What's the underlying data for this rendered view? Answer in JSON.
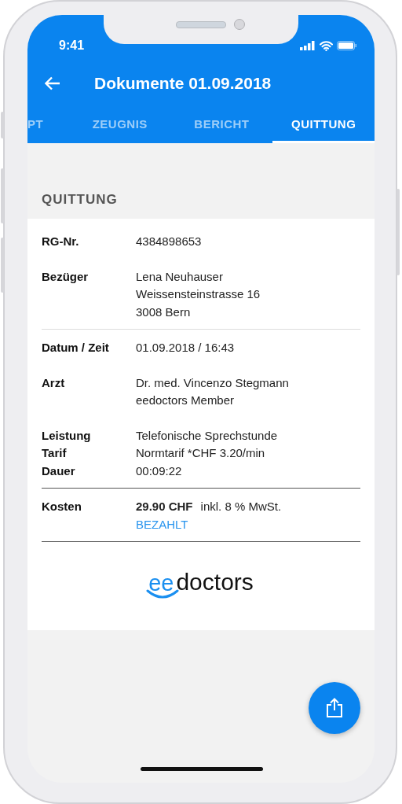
{
  "status_bar": {
    "time": "9:41"
  },
  "header": {
    "title": "Dokumente 01.09.2018"
  },
  "tabs": [
    {
      "label": "PT",
      "selected": false
    },
    {
      "label": "ZEUGNIS",
      "selected": false
    },
    {
      "label": "BERICHT",
      "selected": false
    },
    {
      "label": "QUITTUNG",
      "selected": true
    }
  ],
  "section": {
    "title": "QUITTUNG"
  },
  "groups": [
    {
      "blocks": [
        {
          "kind": "field",
          "lines": [
            {
              "label": "RG-Nr.",
              "value": "4384898653"
            }
          ]
        },
        {
          "kind": "field",
          "lines": [
            {
              "label": "Bezüger",
              "value": "Lena Neuhauser"
            },
            {
              "value": "Weissensteinstrasse 16"
            },
            {
              "value": "3008 Bern"
            }
          ]
        }
      ]
    },
    {
      "blocks": [
        {
          "kind": "field",
          "lines": [
            {
              "label": "Datum / Zeit",
              "value": "01.09.2018 / 16:43"
            }
          ]
        },
        {
          "kind": "field",
          "lines": [
            {
              "label": "Arzt",
              "value": "Dr. med. Vincenzo Stegmann"
            },
            {
              "value": "eedoctors Member"
            }
          ]
        },
        {
          "kind": "field",
          "lines": [
            {
              "label": "Leistung",
              "value": "Telefonische Sprechstunde"
            },
            {
              "label": "Tarif",
              "value": "Normtarif *CHF 3.20/min"
            },
            {
              "label": "Dauer",
              "value": "00:09:22"
            }
          ]
        }
      ]
    },
    {
      "blocks": [
        {
          "kind": "cost",
          "label": "Kosten",
          "amount": "29.90 CHF",
          "note": "inkl. 8 % MwSt.",
          "status": "BEZAHLT"
        }
      ]
    }
  ],
  "logo": {
    "part_1": "ee",
    "part_2": "doctors"
  }
}
